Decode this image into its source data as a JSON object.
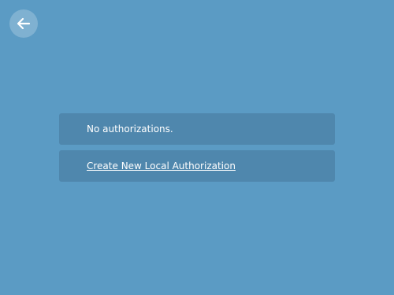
{
  "header": {
    "back_icon": "arrow-left-icon",
    "back_button_bg": "rgba(255,255,255,0.22)"
  },
  "main": {
    "status_text": "No authorizations.",
    "create_link_label": "Create New Local Authorization"
  },
  "colors": {
    "background": "#5b9bc4",
    "panel": "#4f87ad",
    "text": "#ffffff"
  }
}
